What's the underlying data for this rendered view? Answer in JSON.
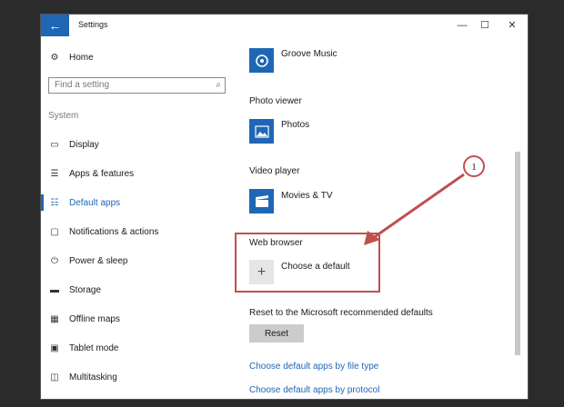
{
  "window": {
    "title": "Settings",
    "back_glyph": "←",
    "minimize_glyph": "—",
    "maximize_glyph": "☐",
    "close_glyph": "✕"
  },
  "sidebar": {
    "home_label": "Home",
    "search_placeholder": "Find a setting",
    "section_label": "System",
    "items": [
      {
        "label": "Display",
        "icon": "monitor-icon"
      },
      {
        "label": "Apps & features",
        "icon": "apps-list-icon"
      },
      {
        "label": "Default apps",
        "icon": "default-apps-icon",
        "active": true
      },
      {
        "label": "Notifications & actions",
        "icon": "notification-icon"
      },
      {
        "label": "Power & sleep",
        "icon": "power-icon"
      },
      {
        "label": "Storage",
        "icon": "storage-icon"
      },
      {
        "label": "Offline maps",
        "icon": "map-icon"
      },
      {
        "label": "Tablet mode",
        "icon": "tablet-icon"
      },
      {
        "label": "Multitasking",
        "icon": "multitasking-icon"
      }
    ]
  },
  "content": {
    "music_app": "Groove Music",
    "photo_heading": "Photo viewer",
    "photo_app": "Photos",
    "video_heading": "Video player",
    "video_app": "Movies & TV",
    "browser_heading": "Web browser",
    "browser_choose": "Choose a default",
    "reset_heading": "Reset to the Microsoft recommended defaults",
    "reset_button": "Reset",
    "link_file_type": "Choose default apps by file type",
    "link_protocol": "Choose default apps by protocol"
  },
  "annotation": {
    "number": "1",
    "color": "#c0504d"
  },
  "colors": {
    "accent": "#1f66b5",
    "background": "#2b2b2b"
  }
}
